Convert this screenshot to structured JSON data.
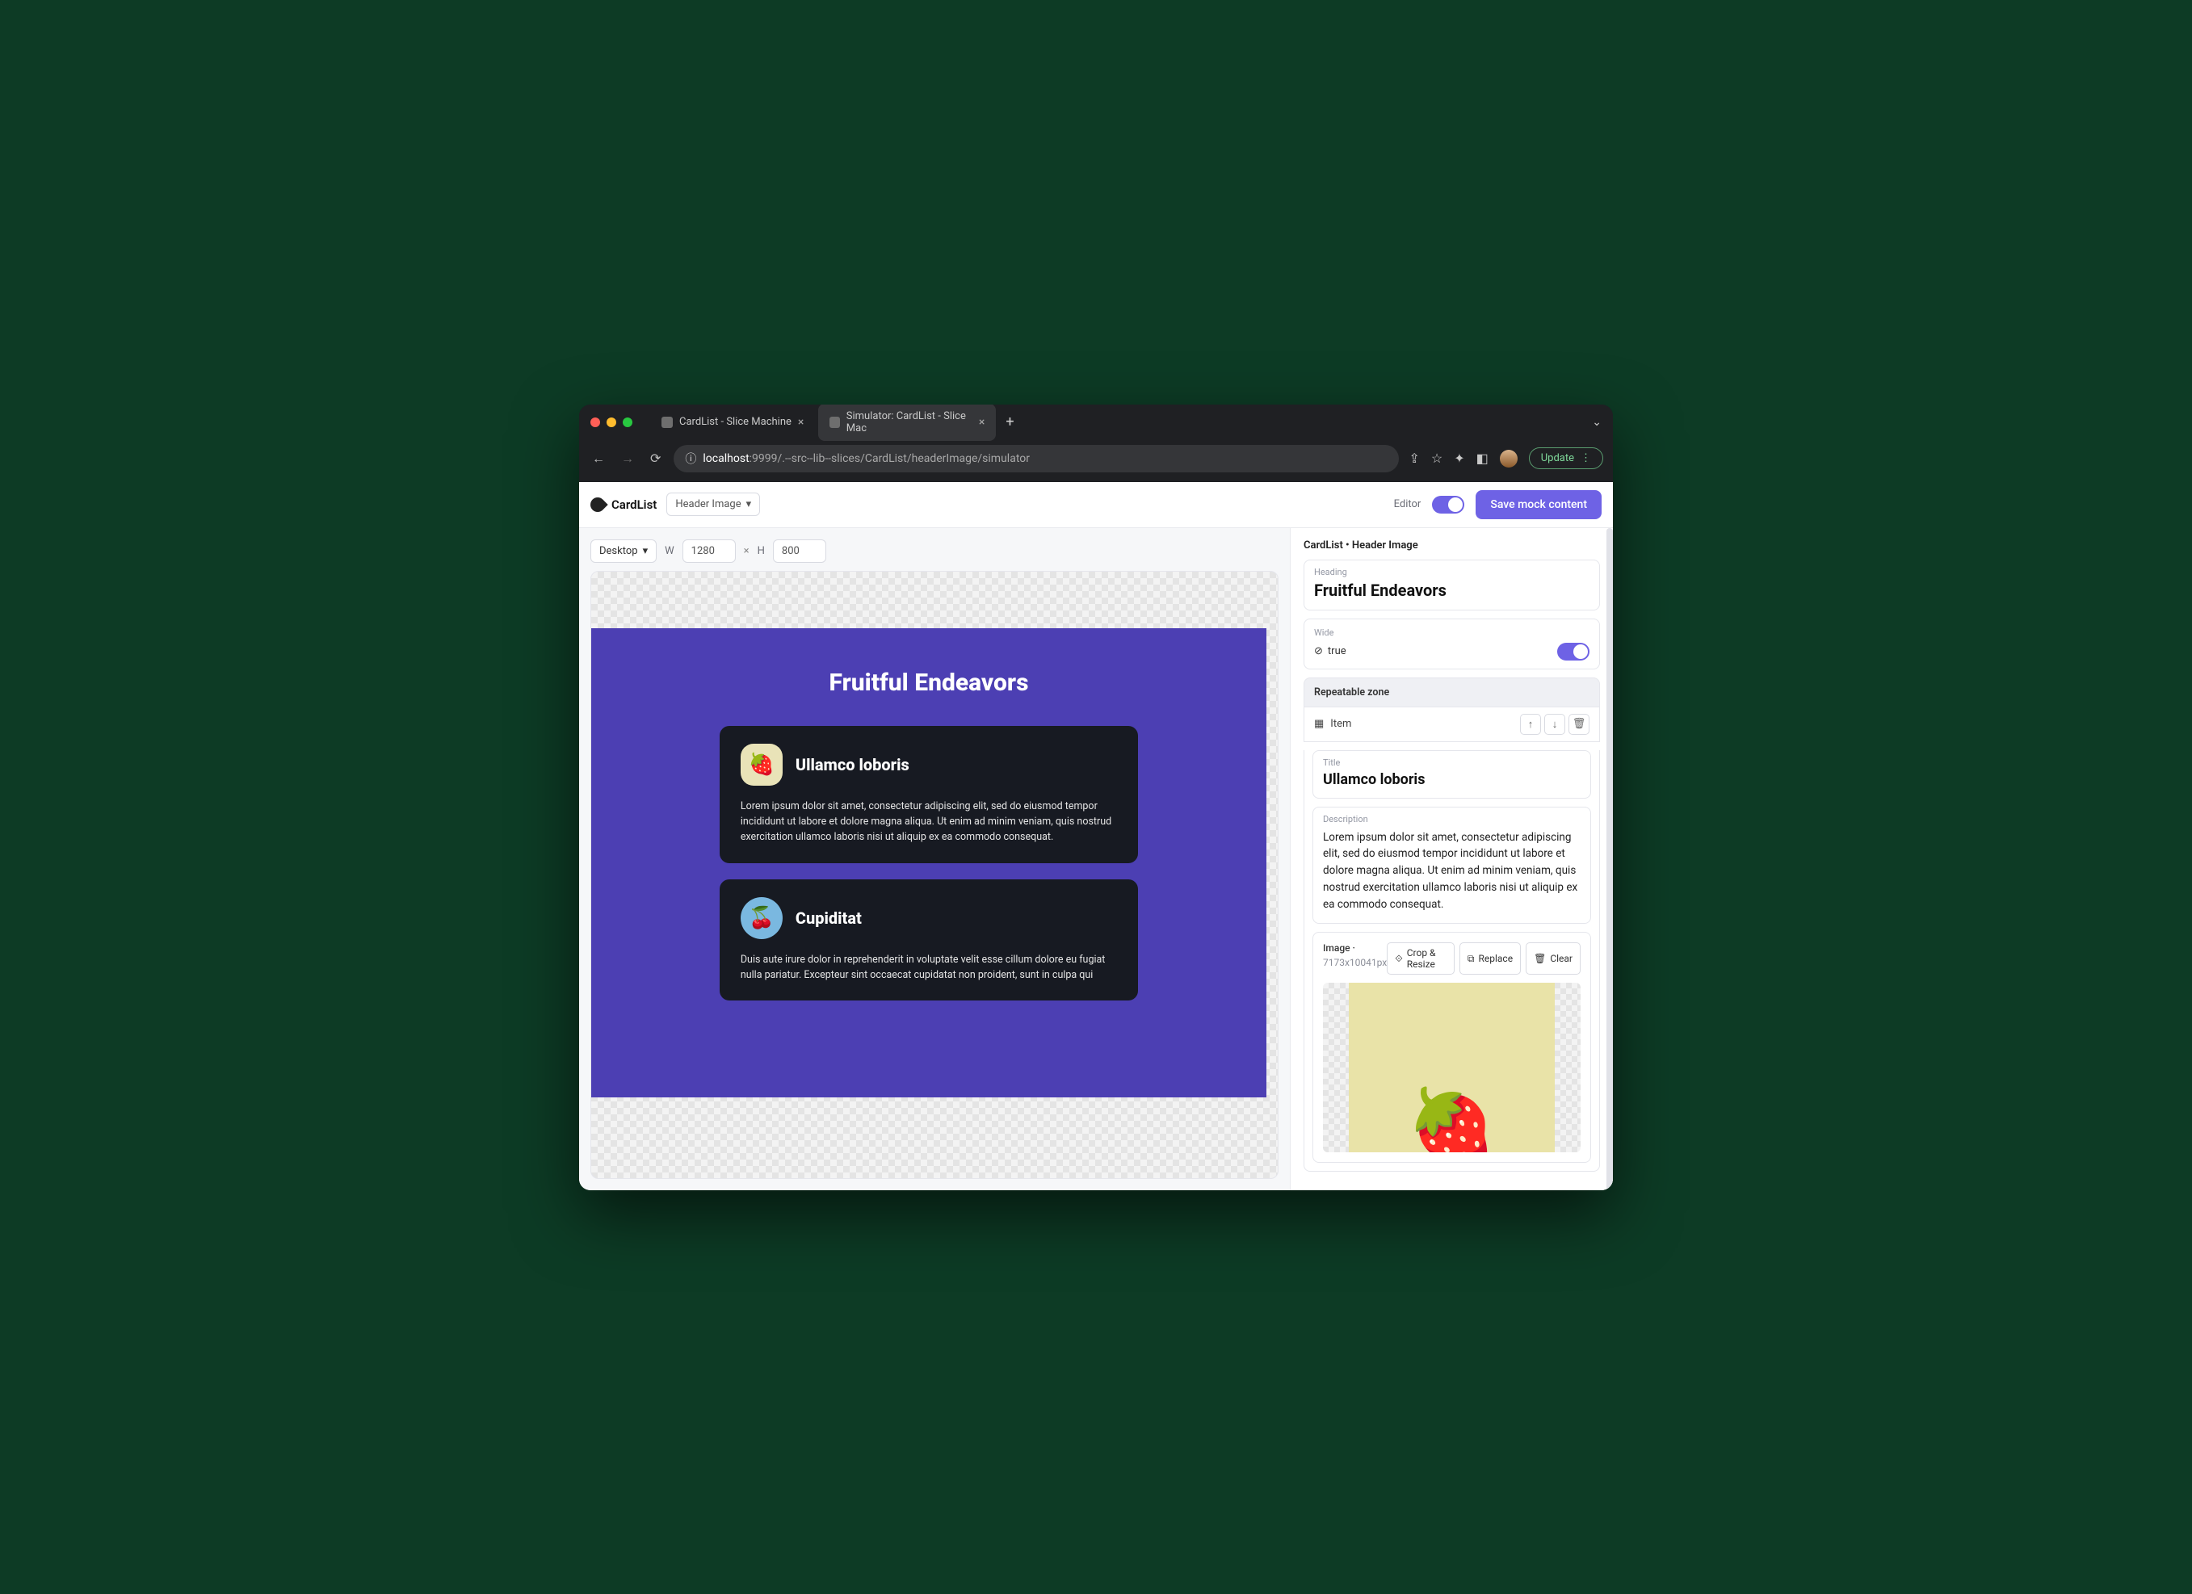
{
  "browser": {
    "tabs": [
      {
        "title": "CardList - Slice Machine"
      },
      {
        "title": "Simulator: CardList - Slice Mac"
      }
    ],
    "url_host": "localhost",
    "url_port": ":9999",
    "url_path": "/.--src--lib--slices/CardList/headerImage/simulator",
    "update_label": "Update"
  },
  "appbar": {
    "brand": "CardList",
    "variation": "Header Image",
    "editor_label": "Editor",
    "save_label": "Save mock content"
  },
  "controls": {
    "device": "Desktop",
    "w_label": "W",
    "width": "1280",
    "x": "×",
    "h_label": "H",
    "height": "800"
  },
  "preview": {
    "heading": "Fruitful Endeavors",
    "cards": [
      {
        "title": "Ullamco loboris",
        "desc": "Lorem ipsum dolor sit amet, consectetur adipiscing elit, sed do eiusmod tempor incididunt ut labore et dolore magna aliqua. Ut enim ad minim veniam, quis nostrud exercitation ullamco laboris nisi ut aliquip ex ea commodo consequat.",
        "emoji": "🍓"
      },
      {
        "title": "Cupiditat",
        "desc": "Duis aute irure dolor in reprehenderit in voluptate velit esse cillum dolore eu fugiat nulla pariatur. Excepteur sint occaecat cupidatat non proident, sunt in culpa qui",
        "emoji": "🍒"
      }
    ]
  },
  "panel": {
    "crumb": "CardList • Header Image",
    "heading_label": "Heading",
    "heading_value": "Fruitful Endeavors",
    "wide_label": "Wide",
    "wide_value": "true",
    "repeat_label": "Repeatable zone",
    "item_label": "Item",
    "title_label": "Title",
    "title_value": "Ullamco loboris",
    "desc_label": "Description",
    "desc_value": "Lorem ipsum dolor sit amet, consectetur adipiscing elit, sed do eiusmod tempor incididunt ut labore et dolore magna aliqua. Ut enim ad minim veniam, quis nostrud exercitation ullamco laboris nisi ut aliquip ex ea commodo consequat.",
    "image_label": "Image",
    "image_dim": "7173x10041px",
    "crop_label": "Crop & Resize",
    "replace_label": "Replace",
    "clear_label": "Clear"
  }
}
